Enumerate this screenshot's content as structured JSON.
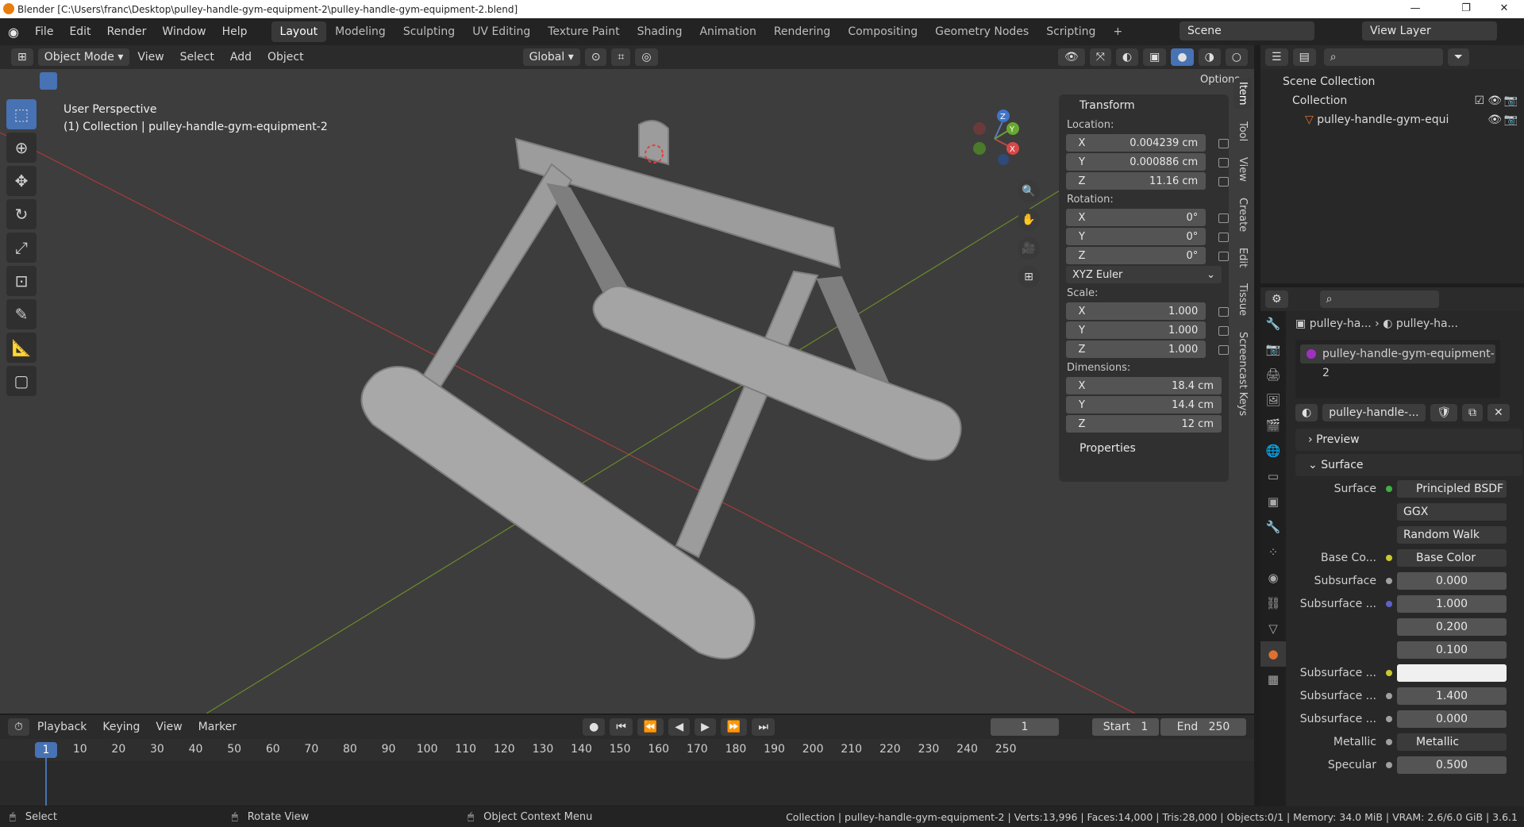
{
  "title_bar": {
    "title": "Blender [C:\\Users\\franc\\Desktop\\pulley-handle-gym-equipment-2\\pulley-handle-gym-equipment-2.blend]",
    "minimize": "—",
    "maximize": "❐",
    "close": "✕"
  },
  "menu": [
    "File",
    "Edit",
    "Render",
    "Window",
    "Help"
  ],
  "workspaces": [
    "Layout",
    "Modeling",
    "Sculpting",
    "UV Editing",
    "Texture Paint",
    "Shading",
    "Animation",
    "Rendering",
    "Compositing",
    "Geometry Nodes",
    "Scripting"
  ],
  "active_workspace": "Layout",
  "add_workspace": "+",
  "scene": {
    "label": "Scene",
    "view_layer": "View Layer"
  },
  "viewport_header": {
    "mode": "Object Mode",
    "menus": [
      "View",
      "Select",
      "Add",
      "Object"
    ],
    "orientation": "Global",
    "options": "Options"
  },
  "viewport": {
    "perspective": "User Perspective",
    "collection_info": "(1) Collection | pulley-handle-gym-equipment-2"
  },
  "gizmo": {
    "x": "X",
    "y": "Y",
    "z": "Z"
  },
  "transform_panel": {
    "title": "Transform",
    "location_label": "Location:",
    "location": [
      {
        "axis": "X",
        "value": "0.004239 cm"
      },
      {
        "axis": "Y",
        "value": "0.000886 cm"
      },
      {
        "axis": "Z",
        "value": "11.16 cm"
      }
    ],
    "rotation_label": "Rotation:",
    "rotation": [
      {
        "axis": "X",
        "value": "0°"
      },
      {
        "axis": "Y",
        "value": "0°"
      },
      {
        "axis": "Z",
        "value": "0°"
      }
    ],
    "rotation_mode": "XYZ Euler",
    "scale_label": "Scale:",
    "scale": [
      {
        "axis": "X",
        "value": "1.000"
      },
      {
        "axis": "Y",
        "value": "1.000"
      },
      {
        "axis": "Z",
        "value": "1.000"
      }
    ],
    "dimensions_label": "Dimensions:",
    "dimensions": [
      {
        "axis": "X",
        "value": "18.4 cm"
      },
      {
        "axis": "Y",
        "value": "14.4 cm"
      },
      {
        "axis": "Z",
        "value": "12 cm"
      }
    ],
    "properties": "Properties"
  },
  "side_tabs": [
    "Item",
    "Tool",
    "View",
    "Create",
    "Edit",
    "Tissue",
    "Screencast Keys"
  ],
  "outliner": {
    "scene_collection": "Scene Collection",
    "collection": "Collection",
    "object": "pulley-handle-gym-equi"
  },
  "properties_editor": {
    "breadcrumb_object": "pulley-ha...",
    "breadcrumb_material": "pulley-ha...",
    "material_slot": "pulley-handle-gym-equipment-2",
    "material_name": "pulley-handle-...",
    "sections": {
      "preview": "Preview",
      "surface": "Surface"
    },
    "rows": [
      {
        "label": "Surface",
        "value": "Principled BSDF",
        "kind": "node",
        "dot": "#40b040"
      },
      {
        "label": "",
        "value": "GGX",
        "kind": "dropdown"
      },
      {
        "label": "",
        "value": "Random Walk",
        "kind": "dropdown"
      },
      {
        "label": "Base Co...",
        "value": "Base Color",
        "kind": "node",
        "dot": "#c8c830"
      },
      {
        "label": "Subsurface",
        "value": "0.000",
        "kind": "num",
        "dot": "#a0a0a0"
      },
      {
        "label": "Subsurface ...",
        "value": "1.000",
        "kind": "num",
        "dot": "#6060c8"
      },
      {
        "label": "",
        "value": "0.200",
        "kind": "num"
      },
      {
        "label": "",
        "value": "0.100",
        "kind": "num"
      },
      {
        "label": "Subsurface ...",
        "value": "",
        "kind": "color",
        "dot": "#c8c830"
      },
      {
        "label": "Subsurface ...",
        "value": "1.400",
        "kind": "num",
        "dot": "#a0a0a0"
      },
      {
        "label": "Subsurface ...",
        "value": "0.000",
        "kind": "num",
        "dot": "#a0a0a0"
      },
      {
        "label": "Metallic",
        "value": "Metallic",
        "kind": "node",
        "dot": "#a0a0a0"
      },
      {
        "label": "Specular",
        "value": "0.500",
        "kind": "num",
        "dot": "#a0a0a0"
      }
    ]
  },
  "timeline_header": {
    "menus": [
      "Playback",
      "Keying",
      "View",
      "Marker"
    ],
    "current_frame": "1",
    "start_label": "Start",
    "start": "1",
    "end_label": "End",
    "end": "250"
  },
  "timeline": {
    "current": "1",
    "ticks": [
      "10",
      "20",
      "30",
      "40",
      "50",
      "60",
      "70",
      "80",
      "90",
      "100",
      "110",
      "120",
      "130",
      "140",
      "150",
      "160",
      "170",
      "180",
      "190",
      "200",
      "210",
      "220",
      "230",
      "240",
      "250"
    ]
  },
  "status_bar": {
    "select": "Select",
    "rotate": "Rotate View",
    "context": "Object Context Menu",
    "stats": "Collection | pulley-handle-gym-equipment-2 | Verts:13,996 | Faces:14,000 | Tris:28,000 | Objects:0/1 | Memory: 34.0 MiB | VRAM: 2.6/6.0 GiB | 3.6.1"
  }
}
